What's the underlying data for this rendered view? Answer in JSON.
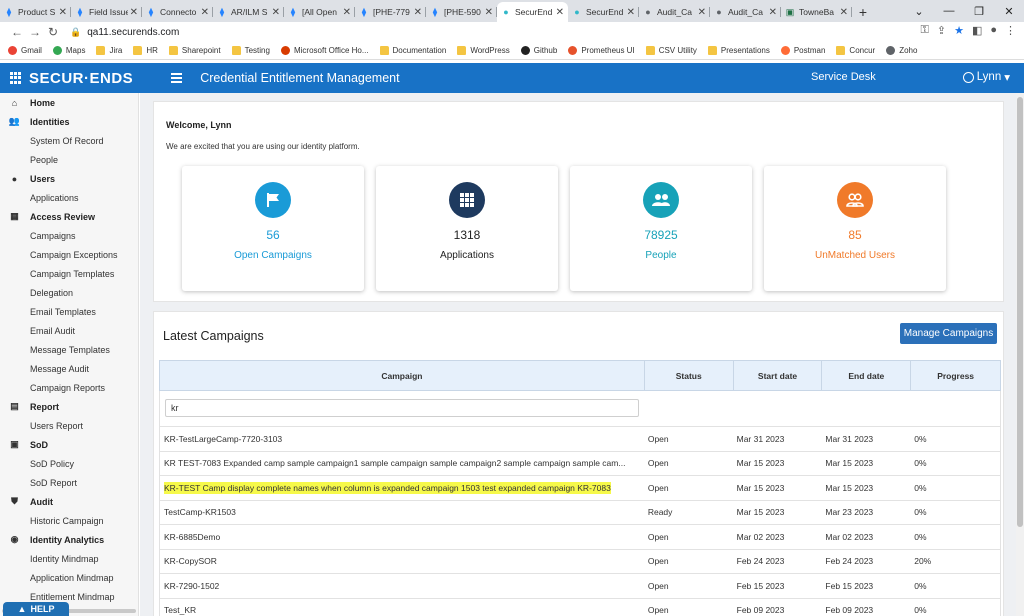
{
  "browser": {
    "tabs": [
      {
        "label": "Product S",
        "icon": "jira"
      },
      {
        "label": "Field Issue",
        "icon": "jira"
      },
      {
        "label": "Connecto",
        "icon": "jira"
      },
      {
        "label": "AR/ILM S",
        "icon": "jira"
      },
      {
        "label": "[All Open",
        "icon": "jira"
      },
      {
        "label": "[PHE-779",
        "icon": "jira"
      },
      {
        "label": "[PHE-590",
        "icon": "jira"
      },
      {
        "label": "SecurEnd",
        "icon": "securends"
      },
      {
        "label": "SecurEnd",
        "icon": "securends"
      },
      {
        "label": "Audit_Ca",
        "icon": "globe"
      },
      {
        "label": "Audit_Ca",
        "icon": "globe"
      },
      {
        "label": "TowneBa",
        "icon": "excel"
      }
    ],
    "url": "qa11.securends.com",
    "bookmarks": [
      {
        "label": "Gmail",
        "icon": "google"
      },
      {
        "label": "Maps",
        "icon": "maps"
      },
      {
        "label": "Jira",
        "icon": "folder"
      },
      {
        "label": "HR",
        "icon": "folder"
      },
      {
        "label": "Sharepoint",
        "icon": "folder"
      },
      {
        "label": "Testing",
        "icon": "folder"
      },
      {
        "label": "Microsoft Office Ho...",
        "icon": "office"
      },
      {
        "label": "Documentation",
        "icon": "folder"
      },
      {
        "label": "WordPress",
        "icon": "folder"
      },
      {
        "label": "Github",
        "icon": "github"
      },
      {
        "label": "Prometheus UI",
        "icon": "prometheus"
      },
      {
        "label": "CSV Utility",
        "icon": "folder"
      },
      {
        "label": "Presentations",
        "icon": "folder"
      },
      {
        "label": "Postman",
        "icon": "postman"
      },
      {
        "label": "Concur",
        "icon": "folder"
      },
      {
        "label": "Zoho",
        "icon": "globe"
      }
    ]
  },
  "header": {
    "brand": "SECUR·ENDS",
    "title": "Credential Entitlement Management",
    "service_desk": "Service Desk",
    "user": "Lynn"
  },
  "sidebar": {
    "items": [
      {
        "label": "Home",
        "type": "section",
        "icon": "home-icon"
      },
      {
        "label": "Identities",
        "type": "section",
        "icon": "people-icon"
      },
      {
        "label": "System Of Record",
        "type": "sub"
      },
      {
        "label": "People",
        "type": "sub"
      },
      {
        "label": "Users",
        "type": "section",
        "icon": "user-icon"
      },
      {
        "label": "Applications",
        "type": "sub"
      },
      {
        "label": "Access Review",
        "type": "section",
        "icon": "grid-icon"
      },
      {
        "label": "Campaigns",
        "type": "sub"
      },
      {
        "label": "Campaign Exceptions",
        "type": "sub"
      },
      {
        "label": "Campaign Templates",
        "type": "sub"
      },
      {
        "label": "Delegation",
        "type": "sub"
      },
      {
        "label": "Email Templates",
        "type": "sub"
      },
      {
        "label": "Email Audit",
        "type": "sub"
      },
      {
        "label": "Message Templates",
        "type": "sub"
      },
      {
        "label": "Message Audit",
        "type": "sub"
      },
      {
        "label": "Campaign Reports",
        "type": "sub"
      },
      {
        "label": "Report",
        "type": "section",
        "icon": "report-icon"
      },
      {
        "label": "Users Report",
        "type": "sub"
      },
      {
        "label": "SoD",
        "type": "section",
        "icon": "sod-icon"
      },
      {
        "label": "SoD Policy",
        "type": "sub"
      },
      {
        "label": "SoD Report",
        "type": "sub"
      },
      {
        "label": "Audit",
        "type": "section",
        "icon": "shield-icon"
      },
      {
        "label": "Historic Campaign",
        "type": "sub"
      },
      {
        "label": "Identity Analytics",
        "type": "section",
        "icon": "analytics-icon"
      },
      {
        "label": "Identity Mindmap",
        "type": "sub"
      },
      {
        "label": "Application Mindmap",
        "type": "sub"
      },
      {
        "label": "Entitlement Mindmap",
        "type": "sub"
      }
    ],
    "help": "HELP"
  },
  "welcome": {
    "title": "Welcome, Lynn",
    "subtitle": "We are excited that you are using our identity platform."
  },
  "stats": [
    {
      "value": "56",
      "label": "Open Campaigns",
      "color": "#1a9bd7",
      "text_color": "#1a9bd7",
      "icon": "flag-icon"
    },
    {
      "value": "1318",
      "label": "Applications",
      "color": "#1e3a5f",
      "text_color": "#222222",
      "icon": "apps-grid-icon"
    },
    {
      "value": "78925",
      "label": "People",
      "color": "#17a2b8",
      "text_color": "#17a2b8",
      "icon": "people-icon"
    },
    {
      "value": "85",
      "label": "UnMatched Users",
      "color": "#f07a2a",
      "text_color": "#f07a2a",
      "icon": "unmatched-users-icon"
    }
  ],
  "campaigns": {
    "title": "Latest Campaigns",
    "manage_button": "Manage Campaigns",
    "columns": [
      "Campaign",
      "Status",
      "Start date",
      "End date",
      "Progress"
    ],
    "filter_value": "kr",
    "rows": [
      {
        "campaign": "KR-TestLargeCamp-7720-3103",
        "status": "Open",
        "start": "Mar 31 2023",
        "end": "Mar 31 2023",
        "progress": "0%",
        "highlight": false
      },
      {
        "campaign": "KR TEST-7083 Expanded camp sample campaign1 sample campaign sample campaign2 sample campaign sample cam...",
        "status": "Open",
        "start": "Mar 15 2023",
        "end": "Mar 15 2023",
        "progress": "0%",
        "highlight": false
      },
      {
        "campaign": "KR-TEST Camp display complete names when column is expanded campaign 1503 test expanded campaign KR-7083",
        "status": "Open",
        "start": "Mar 15 2023",
        "end": "Mar 15 2023",
        "progress": "0%",
        "highlight": true
      },
      {
        "campaign": "TestCamp-KR1503",
        "status": "Ready",
        "start": "Mar 15 2023",
        "end": "Mar 23 2023",
        "progress": "0%",
        "highlight": false
      },
      {
        "campaign": "KR-6885Demo",
        "status": "Open",
        "start": "Mar 02 2023",
        "end": "Mar 02 2023",
        "progress": "0%",
        "highlight": false
      },
      {
        "campaign": "KR-CopySOR",
        "status": "Open",
        "start": "Feb 24 2023",
        "end": "Feb 24 2023",
        "progress": "20%",
        "highlight": false
      },
      {
        "campaign": "KR-7290-1502",
        "status": "Open",
        "start": "Feb 15 2023",
        "end": "Feb 15 2023",
        "progress": "0%",
        "highlight": false
      },
      {
        "campaign": "Test_KR",
        "status": "Open",
        "start": "Feb 09 2023",
        "end": "Feb 09 2023",
        "progress": "0%",
        "highlight": false
      }
    ]
  }
}
